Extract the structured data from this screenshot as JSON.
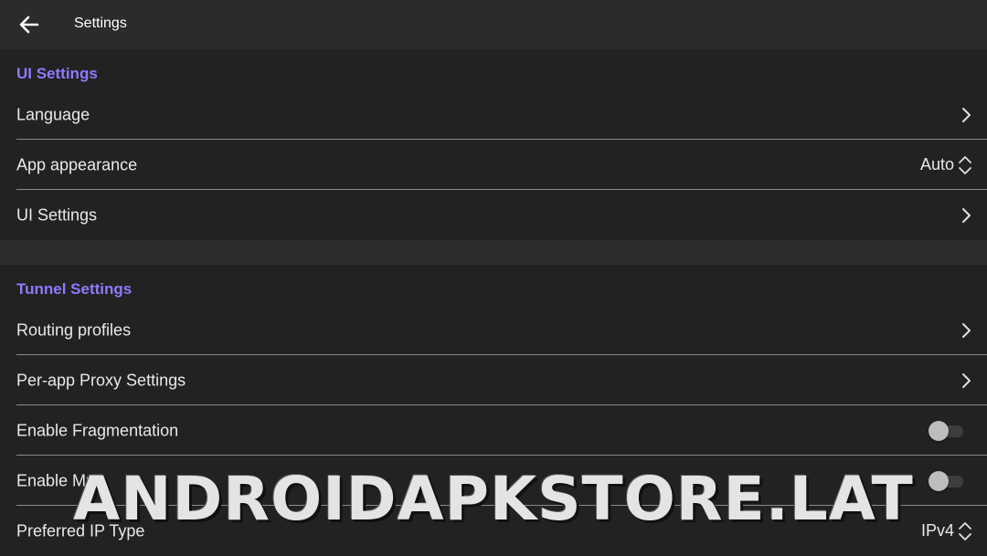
{
  "app_bar": {
    "title": "Settings",
    "back_icon": "arrow-left-icon"
  },
  "sections": [
    {
      "header": "UI Settings",
      "rows": [
        {
          "label": "Language",
          "control": "chevron"
        },
        {
          "label": "App appearance",
          "control": "select",
          "value": "Auto"
        },
        {
          "label": "UI Settings",
          "control": "chevron"
        }
      ]
    },
    {
      "header": "Tunnel Settings",
      "rows": [
        {
          "label": "Routing profiles",
          "control": "chevron"
        },
        {
          "label": "Per-app Proxy Settings",
          "control": "chevron"
        },
        {
          "label": "Enable Fragmentation",
          "control": "toggle",
          "checked": false
        },
        {
          "label": "Enable Mux",
          "control": "toggle",
          "checked": false
        },
        {
          "label": "Preferred IP Type",
          "control": "select",
          "value": "IPv4"
        }
      ]
    }
  ],
  "watermark": "ANDROIDAPKSTORE.LAT",
  "colors": {
    "accent": "#8c7bff",
    "background": "#222222",
    "app_bar": "#2b2b2b",
    "text": "#e9e9e9"
  }
}
